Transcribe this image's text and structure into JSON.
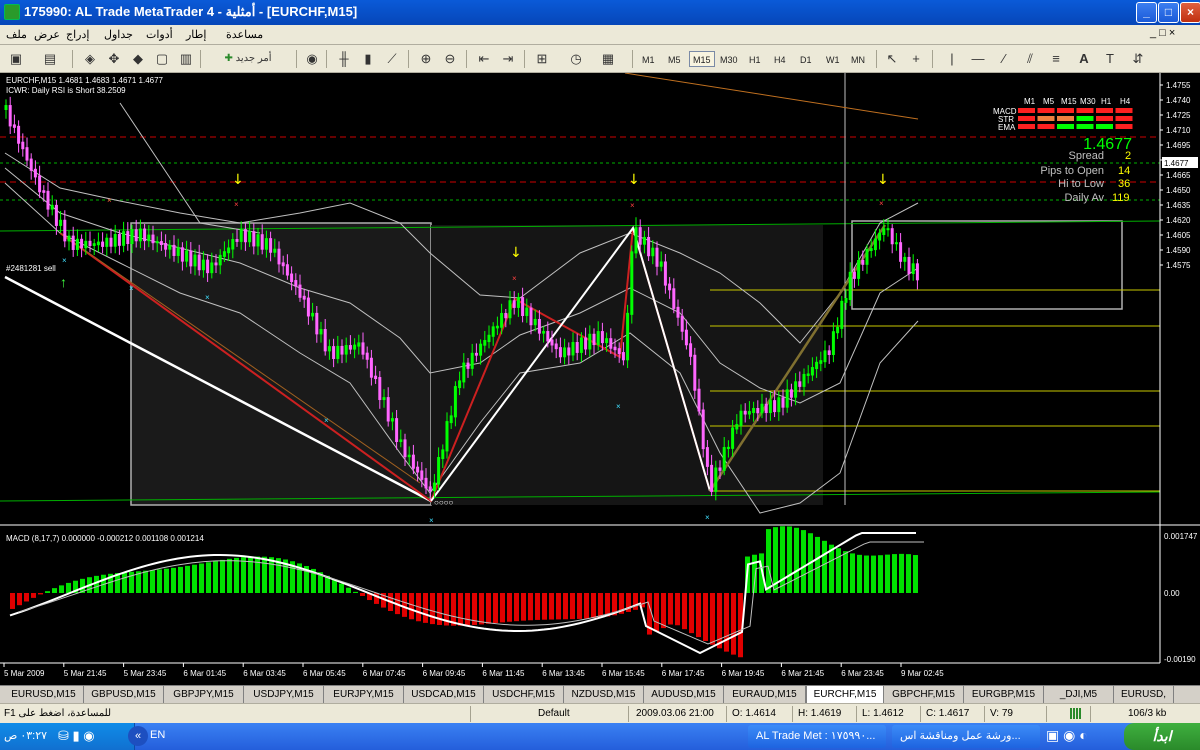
{
  "window": {
    "title": "175990: AL Trade MetaTrader 4 - أمثلية - [EURCHF,M15]"
  },
  "menu": [
    "ملف",
    "عرض",
    "إدراج",
    "جداول",
    "أدوات",
    "إطار",
    "مساعدة"
  ],
  "toolbar": {
    "new_order": "أمر جديد",
    "timeframes": [
      "M1",
      "M5",
      "M15",
      "M30",
      "H1",
      "H4",
      "D1",
      "W1",
      "MN"
    ],
    "active_timeframe": "M15"
  },
  "chart": {
    "header": "EURCHF,M15  1.4681 1.4683 1.4671 1.4677",
    "indicator_note": "ICWR: Daily RSI is Short 38.2509",
    "order_label": "#2481281 sell",
    "price_ticks": [
      "1.4755",
      "1.4740",
      "1.4725",
      "1.4710",
      "1.4695",
      "1.4680",
      "1.4677",
      "1.4665",
      "1.4650",
      "1.4635",
      "1.4620",
      "1.4605",
      "1.4590",
      "1.4575"
    ],
    "current_price": "1.4677",
    "time_ticks": [
      "5 Mar 2009",
      "5 Mar 21:45",
      "5 Mar 23:45",
      "6 Mar 01:45",
      "6 Mar 03:45",
      "6 Mar 05:45",
      "6 Mar 07:45",
      "6 Mar 09:45",
      "6 Mar 11:45",
      "6 Mar 13:45",
      "6 Mar 15:45",
      "6 Mar 17:45",
      "6 Mar 19:45",
      "6 Mar 21:45",
      "6 Mar 23:45",
      "9 Mar 02:45"
    ],
    "macd_label": "MACD  (8,17,7) 0.000000 -0.000212 0.001108 0.001214",
    "macd_ticks": [
      "0.001747",
      "0.00",
      "-0.00190"
    ],
    "colors": {
      "bull": "#00ff00",
      "bear": "#ff66ff",
      "background": "#000000",
      "macd_pos": "#00e000",
      "macd_neg": "#e00000"
    }
  },
  "info_panel": {
    "tf_headers": [
      "M1",
      "M5",
      "M15",
      "M30",
      "H1",
      "H4"
    ],
    "rows": [
      "MACD",
      "STR",
      "EMA"
    ],
    "price": "1.4677",
    "stats": [
      {
        "label": "Spread",
        "value": "2"
      },
      {
        "label": "Pips to Open",
        "value": "14"
      },
      {
        "label": "Hi to Low",
        "value": "36"
      },
      {
        "label": "Daily Av",
        "value": "119"
      }
    ]
  },
  "symbol_tabs": [
    "EURUSD,M15",
    "GBPUSD,M15",
    "GBPJPY,M15",
    "USDJPY,M15",
    "EURJPY,M15",
    "USDCAD,M15",
    "USDCHF,M15",
    "NZDUSD,M15",
    "AUDUSD,M15",
    "EURAUD,M15",
    "EURCHF,M15",
    "GBPCHF,M15",
    "EURGBP,M15",
    "_DJI,M5",
    "EURUSD,"
  ],
  "active_tab": "EURCHF,M15",
  "statusbar": {
    "help": "F1 للمساعدة، اضغط على",
    "profile": "Default",
    "datetime": "2009.03.06 21:00",
    "open": "O: 1.4614",
    "high": "H: 1.4619",
    "low": "L: 1.4612",
    "close": "C: 1.4617",
    "volume": "V: 79",
    "traffic": "106/3 kb"
  },
  "taskbar": {
    "clock": "٠٣:٢٧ ص",
    "lang": "EN",
    "task1": "AL Trade Met : ١٧٥٩٩٠...",
    "task2": "ورشة عمل ومناقشة اس...",
    "start": "ابدأ"
  }
}
